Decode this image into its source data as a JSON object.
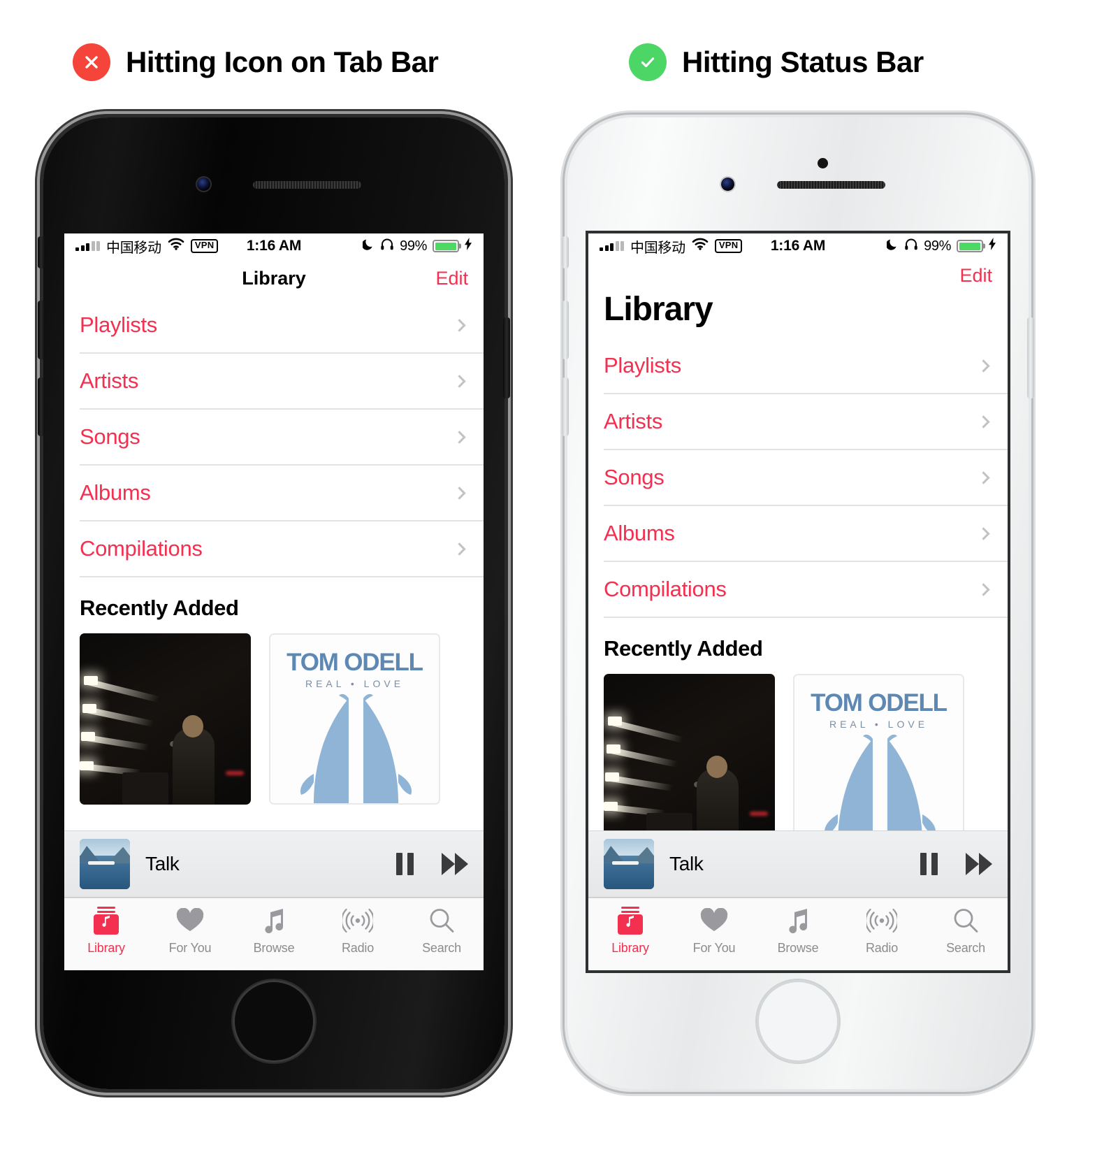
{
  "panels": [
    {
      "id": "left",
      "badge": "x-icon",
      "badge_color": "#F5453A",
      "caption": "Hitting Icon on Tab Bar",
      "device_color": "black",
      "nav_style": "compact"
    },
    {
      "id": "right",
      "badge": "check-icon",
      "badge_color": "#4CD666",
      "caption": "Hitting Status Bar",
      "device_color": "white",
      "nav_style": "large-title"
    }
  ],
  "status_bar": {
    "carrier": "中国移动",
    "wifi_icon": "wifi-icon",
    "vpn_label": "VPN",
    "time": "1:16 AM",
    "dnd_icon": "moon-icon",
    "headphones_icon": "headphones-icon",
    "battery_percent": "99%",
    "charging_icon": "lightning-bolt-icon",
    "battery_color": "#4CD964"
  },
  "nav": {
    "title": "Library",
    "edit_label": "Edit",
    "accent_color": "#F3304F"
  },
  "library_rows": [
    {
      "label": "Playlists"
    },
    {
      "label": "Artists"
    },
    {
      "label": "Songs"
    },
    {
      "label": "Albums"
    },
    {
      "label": "Compilations"
    }
  ],
  "recently_added": {
    "heading": "Recently Added",
    "albums": [
      {
        "name": "concert-photo-album",
        "title": "",
        "subtitle": ""
      },
      {
        "name": "tom-odell-real-love-album",
        "title": "TOM ODELL",
        "subtitle": "REAL • LOVE"
      }
    ]
  },
  "mini_player": {
    "track_title": "Talk",
    "artwork_name": "lake-mountain-artwork",
    "pause_icon": "pause-icon",
    "next_icon": "fast-forward-icon"
  },
  "tab_bar": {
    "active_color": "#F3304F",
    "inactive_color": "#8C8C90",
    "tabs": [
      {
        "label": "Library",
        "icon": "library-icon",
        "active": true
      },
      {
        "label": "For You",
        "icon": "heart-icon",
        "active": false
      },
      {
        "label": "Browse",
        "icon": "music-note-icon",
        "active": false
      },
      {
        "label": "Radio",
        "icon": "radio-waves-icon",
        "active": false
      },
      {
        "label": "Search",
        "icon": "search-icon",
        "active": false
      }
    ]
  }
}
